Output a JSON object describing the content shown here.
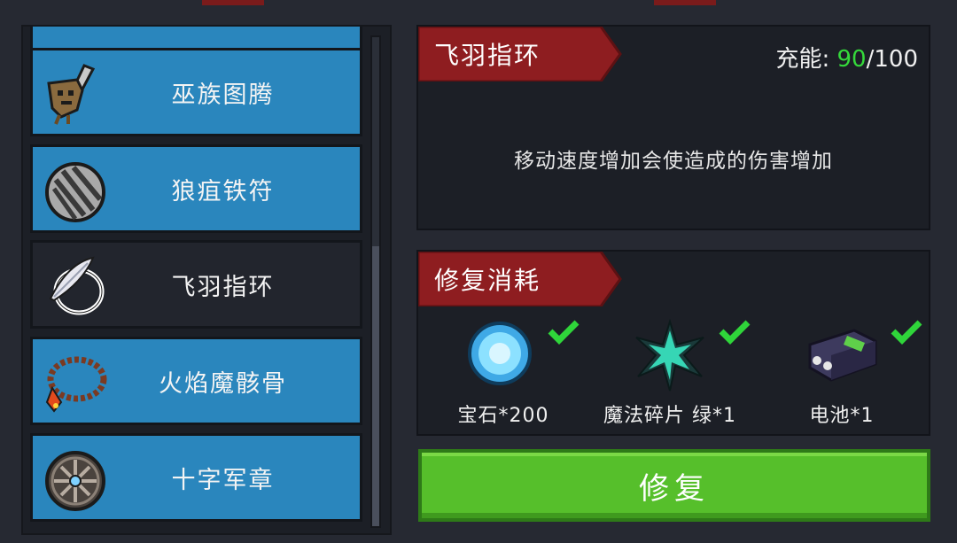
{
  "relic_list": {
    "items": [
      {
        "label": "",
        "icon": "relic-partial-icon",
        "selected": false
      },
      {
        "label": "巫族图腾",
        "icon": "totem-icon",
        "selected": false
      },
      {
        "label": "狼疽铁符",
        "icon": "iron-talisman-icon",
        "selected": false
      },
      {
        "label": "飞羽指环",
        "icon": "feather-ring-icon",
        "selected": true
      },
      {
        "label": "火焰魔骸骨",
        "icon": "fire-bone-necklace-icon",
        "selected": false
      },
      {
        "label": "十字军章",
        "icon": "crusader-badge-icon",
        "selected": false
      }
    ]
  },
  "detail": {
    "title": "飞羽指环",
    "energy_label": "充能:",
    "energy_current": "90",
    "energy_sep": "/",
    "energy_max": "100",
    "description": "移动速度增加会使造成的伤害增加"
  },
  "repair_cost": {
    "title": "修复消耗",
    "materials": [
      {
        "label": "宝石*200",
        "icon": "gem-icon",
        "satisfied": true
      },
      {
        "label": "魔法碎片 绿*1",
        "icon": "magic-shard-green-icon",
        "satisfied": true
      },
      {
        "label": "电池*1",
        "icon": "battery-icon",
        "satisfied": true
      }
    ]
  },
  "repair_button": {
    "label": "修复"
  },
  "colors": {
    "item_bg": "#2a86bd",
    "selected_bg": "#22252d",
    "ribbon": "#8e1d20",
    "energy_value": "#35d93b",
    "check": "#2fd53a",
    "repair_button": "#56bf2b"
  }
}
